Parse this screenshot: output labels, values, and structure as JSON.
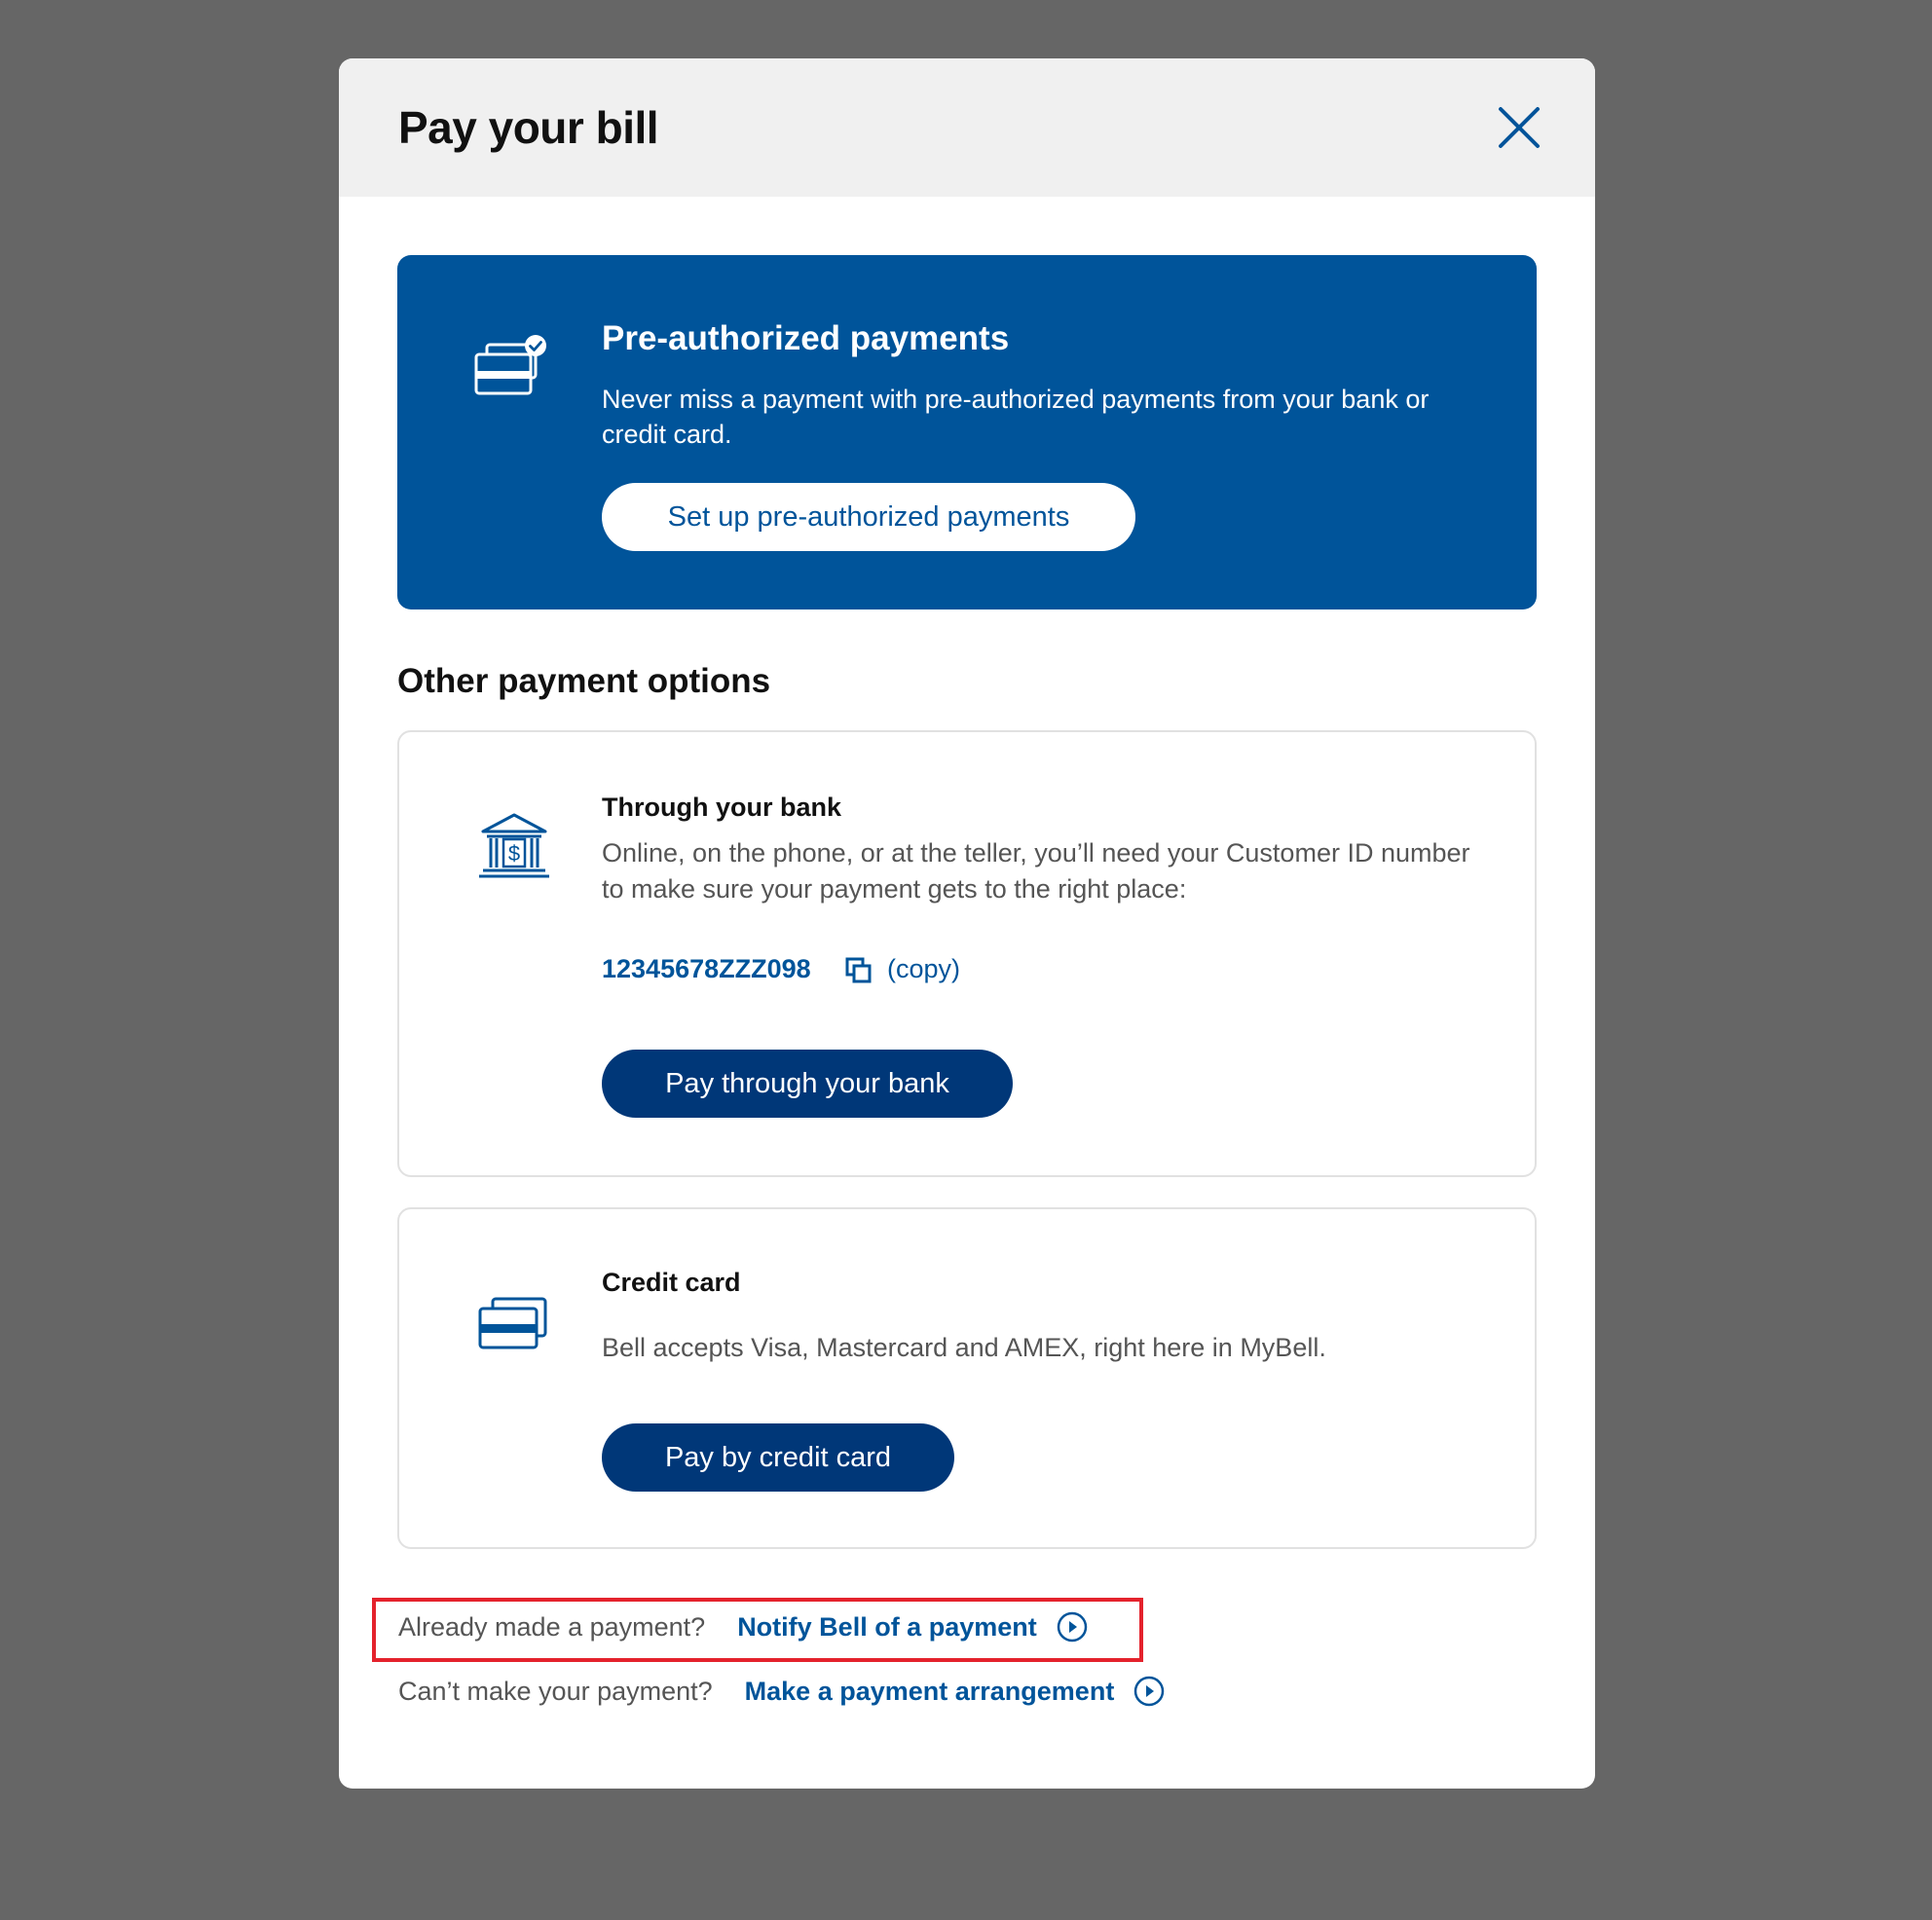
{
  "modal": {
    "title": "Pay your bill",
    "close_icon": "close-icon"
  },
  "pre_authorized": {
    "icon": "credit-card-check-icon",
    "title": "Pre-authorized payments",
    "description": "Never miss a payment with pre-authorized payments from your bank or credit card.",
    "button_label": "Set up pre-authorized payments"
  },
  "other_options": {
    "heading": "Other payment options",
    "bank": {
      "icon": "bank-dollar-icon",
      "title": "Through your bank",
      "description": "Online, on the phone, or at the teller, you’ll need your Customer ID number to make sure your payment gets to the right place:",
      "customer_id": "12345678ZZZ098",
      "copy_icon": "copy-icon",
      "copy_label": "(copy)",
      "button_label": "Pay through your bank"
    },
    "credit_card": {
      "icon": "credit-cards-icon",
      "title": "Credit card",
      "description": "Bell accepts Visa, Mastercard and AMEX, right here in MyBell.",
      "button_label": "Pay by credit card"
    }
  },
  "footer": {
    "notify": {
      "question": "Already made a payment?",
      "link_label": "Notify Bell of a payment",
      "icon": "circle-chevron-right-icon"
    },
    "arrangement": {
      "question": "Can’t make your payment?",
      "link_label": "Make a payment arrangement",
      "icon": "circle-chevron-right-icon"
    }
  },
  "colors": {
    "brand_blue": "#00549a",
    "button_navy": "#003778",
    "overlay": "#666666",
    "highlight_red": "#e4222c"
  }
}
